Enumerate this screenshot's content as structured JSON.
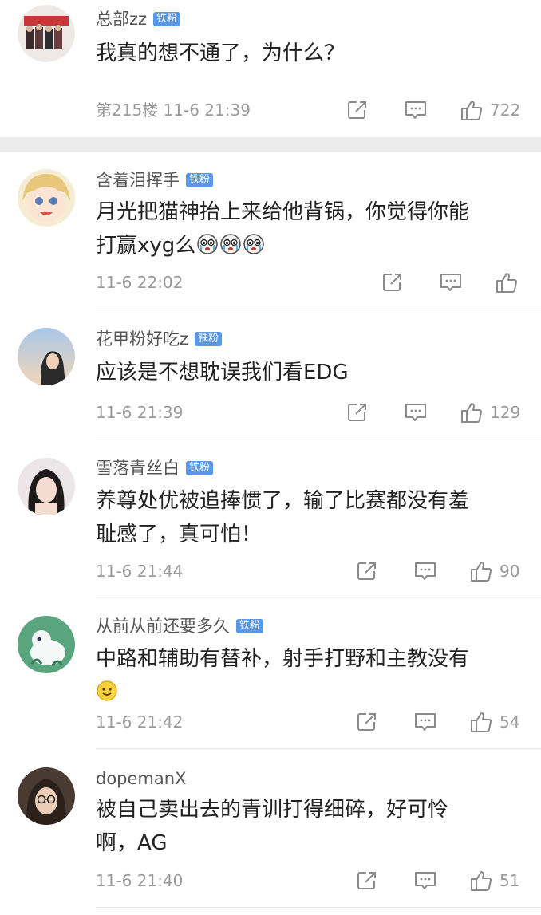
{
  "comments": [
    {
      "username": "总部zz",
      "badge": "铁粉",
      "text_lines": [
        "我真的想不通了，为什么？"
      ],
      "floor": "第215楼",
      "time": "11-6 21:39",
      "likes": "722",
      "avatar_icon": "group-photo-avatar"
    },
    {
      "username": "含着泪挥手",
      "badge": "铁粉",
      "text_lines": [
        "月光把猫神抬上来给他背锅，你觉得你能",
        "打赢xyg么"
      ],
      "emoji_icons": [
        "crying-face-emoji",
        "crying-face-emoji",
        "crying-face-emoji"
      ],
      "time": "11-6 22:02",
      "likes": "",
      "avatar_icon": "anime-girl-avatar"
    },
    {
      "username": "花甲粉好吃z",
      "badge": "铁粉",
      "text_lines": [
        "应该是不想耽误我们看EDG"
      ],
      "time": "11-6 21:39",
      "likes": "129",
      "avatar_icon": "sky-portrait-avatar"
    },
    {
      "username": "雪落青丝白",
      "badge": "铁粉",
      "text_lines": [
        "养尊处优被追捧惯了，输了比赛都没有羞",
        "耻感了，真可怕！"
      ],
      "time": "11-6 21:44",
      "likes": "90",
      "avatar_icon": "girl-portrait-avatar"
    },
    {
      "username": "从前从前还要多久",
      "badge": "铁粉",
      "text_lines": [
        "中路和辅助有替补，射手打野和主教没有"
      ],
      "emoji_icons": [
        "smile-emoji"
      ],
      "time": "11-6 21:42",
      "likes": "54",
      "avatar_icon": "cartoon-animal-avatar"
    },
    {
      "username": "dopemanX",
      "badge": "",
      "text_lines": [
        "被自己卖出去的青训打得细碎，好可怜",
        "啊，AG"
      ],
      "time": "11-6 21:40",
      "likes": "51",
      "avatar_icon": "woman-glasses-avatar"
    }
  ],
  "colors": {
    "badge": "#5a97e6",
    "meta_text": "#9a9a9a",
    "body_text": "#222222",
    "divider_band": "#ececec"
  },
  "action_icons": [
    "share-icon",
    "comment-icon",
    "like-icon"
  ]
}
